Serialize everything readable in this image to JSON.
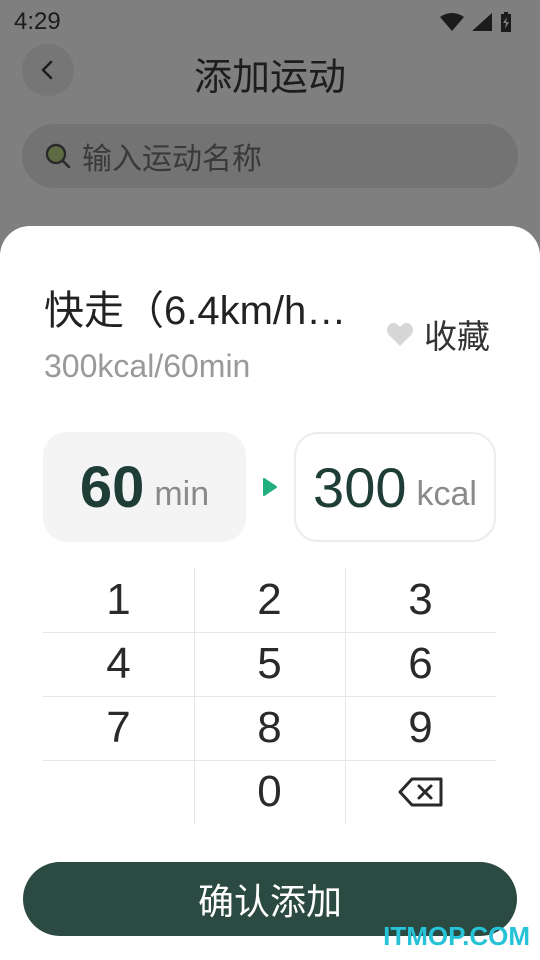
{
  "status_bar": {
    "time": "4:29"
  },
  "header": {
    "title": "添加运动"
  },
  "search": {
    "placeholder": "输入运动名称"
  },
  "sheet": {
    "exercise_name": "快走（6.4km/h…",
    "favorite_label": "收藏",
    "subtitle": "300kcal/60min",
    "duration_value": "60",
    "duration_unit": "min",
    "calorie_value": "300",
    "calorie_unit": "kcal",
    "keypad": [
      "1",
      "2",
      "3",
      "4",
      "5",
      "6",
      "7",
      "8",
      "9",
      "",
      "0",
      "backspace-icon"
    ],
    "confirm_label": "确认添加"
  },
  "colors": {
    "accent": "#2b4a42",
    "arrow": "#1fae7e",
    "number_text": "#1e3d36"
  },
  "watermark": "ITMOP.COM"
}
